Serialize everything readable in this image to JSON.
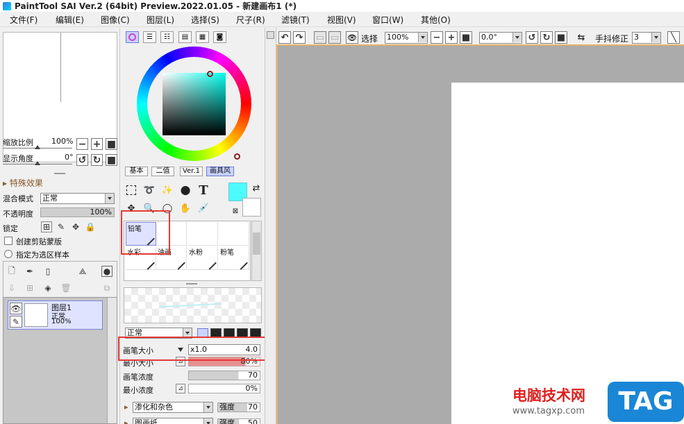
{
  "window": {
    "title": "PaintTool SAI Ver.2 (64bit) Preview.2022.01.05 - 新建画布1 (*)"
  },
  "menu": [
    "文件(F)",
    "编辑(E)",
    "图像(C)",
    "图层(L)",
    "选择(S)",
    "尺子(R)",
    "滤镜(T)",
    "视图(V)",
    "窗口(W)",
    "其他(O)"
  ],
  "navigator": {
    "zoom_label": "缩放比例",
    "zoom_value": "100%",
    "angle_label": "显示角度",
    "angle_value": "0°"
  },
  "layer_props": {
    "section": "特殊效果",
    "blend_label": "混合模式",
    "blend_value": "正常",
    "opacity_label": "不透明度",
    "opacity_value": "100%",
    "lock_label": "锁定",
    "clip_label": "创建剪贴蒙版",
    "sample_label": "指定为选区样本"
  },
  "layers": [
    {
      "name": "图层1",
      "mode": "正常",
      "opacity": "100%"
    }
  ],
  "color_tabs": [
    "基本",
    "二值",
    "Ver.1",
    "画具风"
  ],
  "colors": {
    "foreground": "#4dfafc",
    "background": "#ffffff"
  },
  "brushes": {
    "row1": [
      "铅笔"
    ],
    "row2": [
      "水彩",
      "油画",
      "水粉",
      "粉笔"
    ]
  },
  "brush_settings": {
    "mode": "正常",
    "size_label": "画笔大小",
    "size_mult": "x1.0",
    "size_value": "4.0",
    "min_size_label": "最小大小",
    "min_size_value": "80%",
    "density_label": "画笔浓度",
    "density_value": "70",
    "min_density_label": "最小浓度",
    "min_density_value": "0%",
    "blend_mode": "渗化和杂色",
    "strength_label": "强度",
    "strength_value": "70",
    "paper_label": "图画纸",
    "paper_strength_label": "强度",
    "paper_strength_value": "50"
  },
  "toolbar": {
    "select_label": "选择",
    "zoom_value": "100%",
    "angle_value": "0.0°",
    "stabilizer_label": "手抖修正",
    "stabilizer_value": "3"
  },
  "watermark": {
    "site": "电脑技术网",
    "url": "www.tagxp.com",
    "tag": "TAG"
  }
}
